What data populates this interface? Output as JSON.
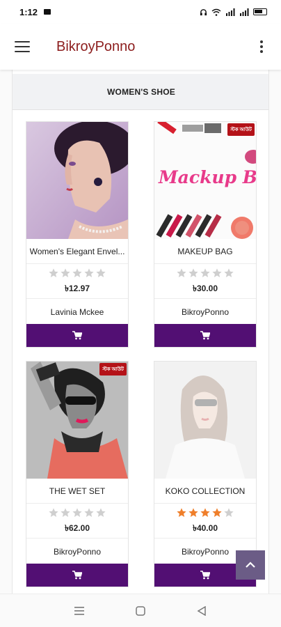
{
  "status_bar": {
    "time": "1:12"
  },
  "app": {
    "title": "BikroyPonno"
  },
  "section": {
    "title": "WOMEN'S SHOE"
  },
  "colors": {
    "brand_title": "#8c1d1d",
    "cart_button": "#520f73",
    "star_filled": "#ef7f2b",
    "star_empty": "#cfcfcf",
    "badge": "#b41218"
  },
  "products": [
    {
      "title": "Women's Elegant Envel...",
      "rating": 0,
      "price": "৳12.97",
      "seller": "Lavinia Mckee",
      "badge": ""
    },
    {
      "title": "MAKEUP BAG",
      "rating": 0,
      "price": "৳30.00",
      "seller": "BikroyPonno",
      "badge": "স্টক আউট",
      "image_text": "Mackup Box"
    },
    {
      "title": "THE WET SET",
      "rating": 0,
      "price": "৳62.00",
      "seller": "BikroyPonno",
      "badge": "স্টক আউট"
    },
    {
      "title": "KOKO COLLECTION",
      "rating": 4,
      "price": "৳40.00",
      "seller": "BikroyPonno",
      "badge": ""
    }
  ],
  "icons": {
    "menu": "hamburger-icon",
    "more": "more-vert-icon",
    "cart": "cart-icon",
    "scroll_top": "chevron-up-icon"
  }
}
